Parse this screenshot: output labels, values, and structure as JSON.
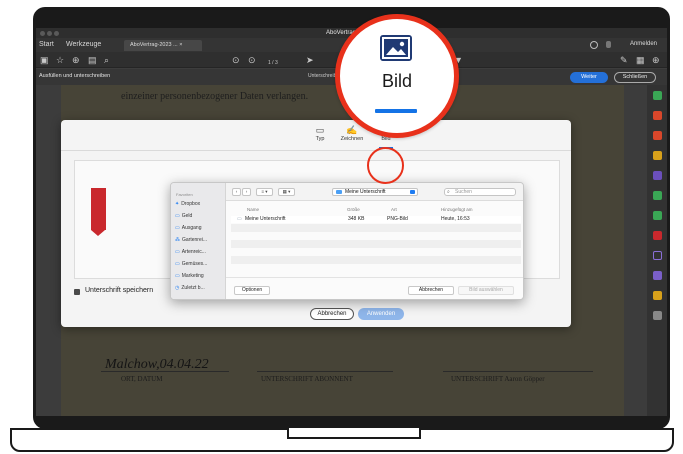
{
  "window": {
    "title": "AboVertrag"
  },
  "menubar": {
    "start": "Start",
    "werkzeuge": "Werkzeuge",
    "doc_tab": "AboVertrag-2023 ...  ×",
    "login": "Anmelden"
  },
  "toolbar": {
    "icons": [
      "save-icon",
      "star-icon",
      "upload-icon",
      "print-icon",
      "zoom-icon"
    ],
    "page_indicator": "1 / 3"
  },
  "signbar": {
    "label": "Ausfüllen und unterschreiben",
    "mini": "Unterschreiben",
    "weiter": "Weiter",
    "schliessen": "Schließen"
  },
  "document": {
    "background_text": "einzeiner personenbezogener Daten verlangen.",
    "handwritten_date": "Malchow,04.04.22",
    "sig_labels": [
      "ORT, DATUM",
      "UNTERSCHRIFT ABONNENT",
      "UNTERSCHRIFT Aaron Göpper"
    ]
  },
  "dialog": {
    "tabs": [
      {
        "label": "Typ",
        "icon": "type-icon"
      },
      {
        "label": "Zeichnen",
        "icon": "draw-icon"
      },
      {
        "label": "Bild",
        "icon": "image-icon"
      }
    ],
    "active_tab": "Bild",
    "save_checkbox_label": "Unterschrift speichern",
    "save_checked": true,
    "abbrechen": "Abbrechen",
    "anwenden": "Anwenden"
  },
  "file_picker": {
    "favorites_heading": "Favoriten",
    "sidebar": [
      "Dropbox",
      "Geld",
      "Ausgang",
      "Gartenrei...",
      "Artenreic...",
      "Gemüses...",
      "Marketing",
      "Zuletzt b..."
    ],
    "location": "Meine Unterschrift",
    "search_placeholder": "Suchen",
    "columns": [
      "Name",
      "Größe",
      "Art",
      "Hinzugefügt am"
    ],
    "files": [
      {
        "name": "Meine Unterschrift",
        "size": "348 KB",
        "kind": "PNG-Bild",
        "added": "Heute, 16:53"
      }
    ],
    "optionen": "Optionen",
    "abbrechen": "Abbrechen",
    "bild_auswaehlen": "Bild auswählen"
  },
  "magnifier": {
    "label": "Bild"
  },
  "colors": {
    "accent": "#1473e6",
    "highlight": "#e8311b",
    "pdf_red": "#c9282d"
  }
}
